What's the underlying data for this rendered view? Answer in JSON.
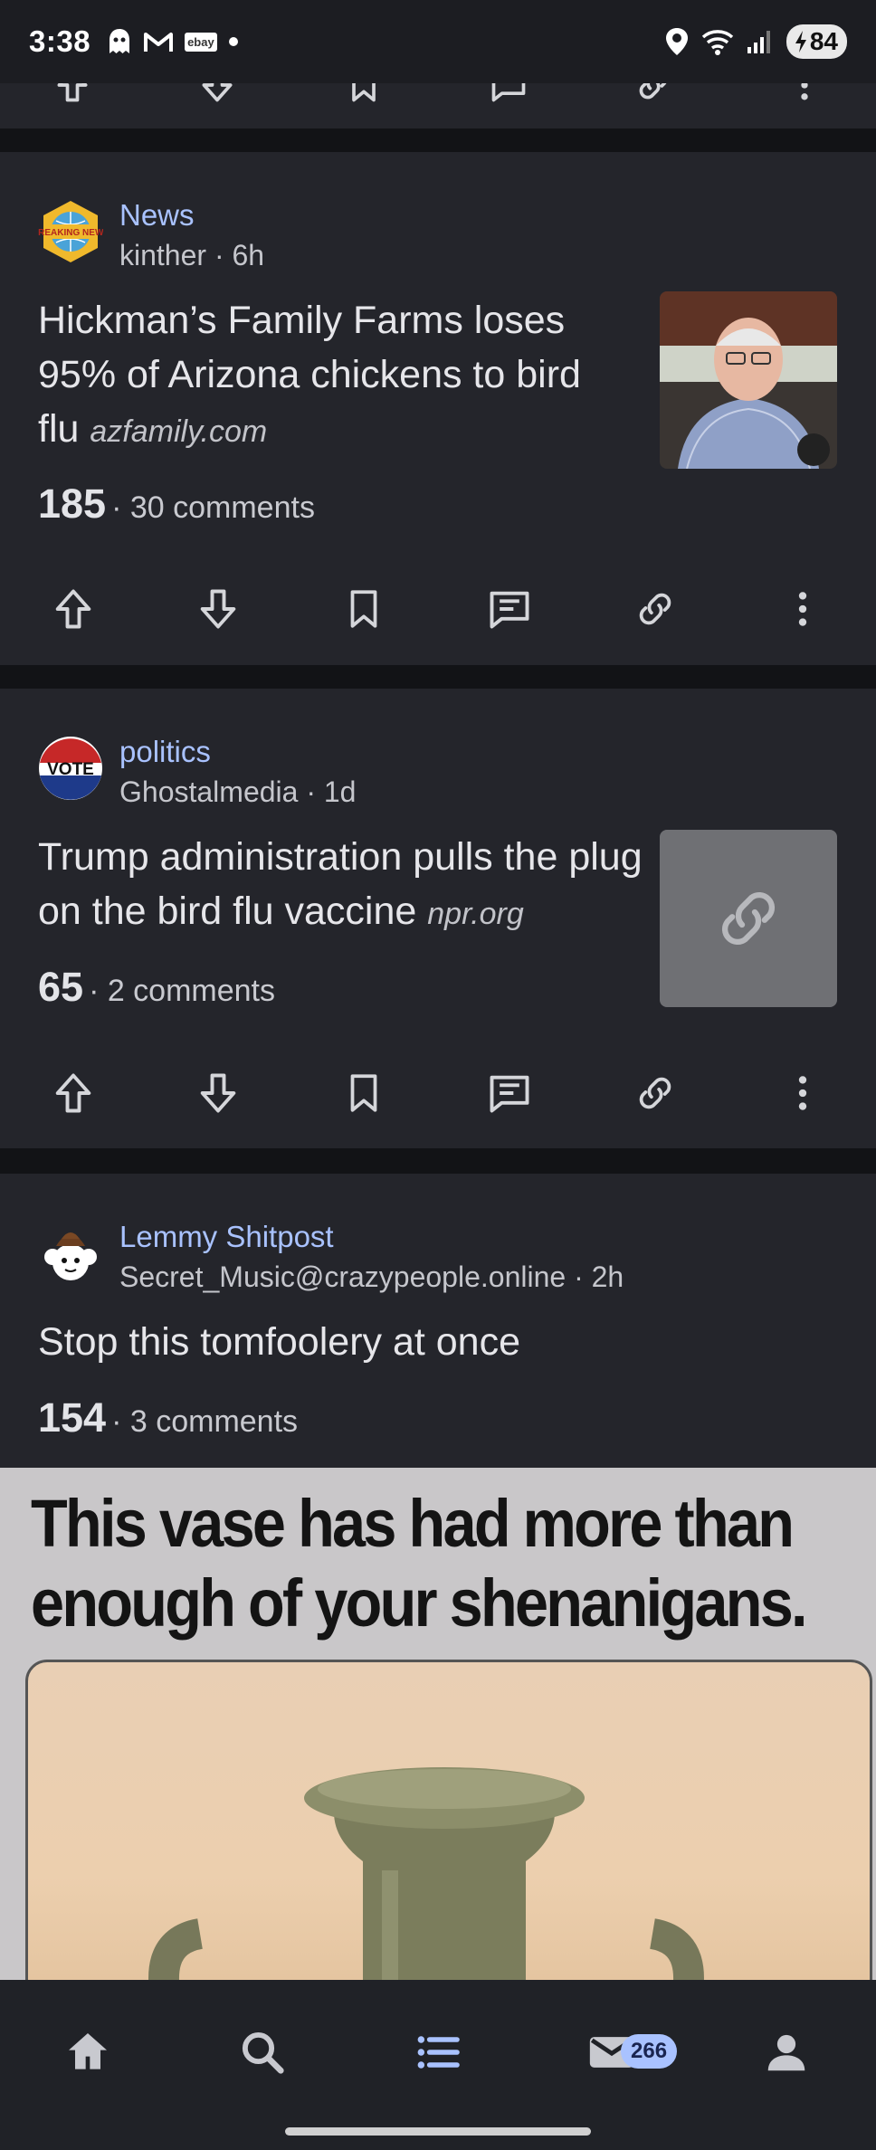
{
  "status_bar": {
    "time": "3:38",
    "left_icons": [
      "ghost-icon",
      "gmail-icon",
      "ebay-icon",
      "dot-icon"
    ],
    "ebay_label": "ebay",
    "right_icons": [
      "location-icon",
      "wifi-icon",
      "signal-icon"
    ],
    "battery": "84"
  },
  "posts": [
    {
      "community": "News",
      "author": "kinther",
      "age": "6h",
      "meta": "kinther · 6h",
      "title": "Hickman’s Family Farms loses 95% of Arizona chickens to bird flu",
      "domain": "azfamily.com",
      "score": "185",
      "comments": "· 30 comments",
      "avatar_label": "BREAKING NEWS"
    },
    {
      "community": "politics",
      "author": "Ghostalmedia",
      "age": "1d",
      "meta": "Ghostalmedia · 1d",
      "title": "Trump administration pulls the plug on the bird flu vaccine",
      "domain": "npr.org",
      "score": "65",
      "comments": "· 2 comments",
      "avatar_label": "VOTE"
    },
    {
      "community": "Lemmy Shitpost",
      "author": "Secret_Music@crazypeople.online",
      "age": "2h",
      "meta": "Secret_Music@crazypeople.online · 2h",
      "title": "Stop this tomfoolery at once",
      "score": "154",
      "comments": "· 3 comments",
      "image_caption_line1": "This vase has had more than",
      "image_caption_line2": "enough of your shenanigans."
    }
  ],
  "post_actions": [
    "upvote",
    "downvote",
    "save",
    "reply",
    "copy-link",
    "more"
  ],
  "bottom_nav": {
    "items": [
      "home",
      "search",
      "feed",
      "inbox",
      "profile"
    ],
    "active": "feed",
    "inbox_badge": "266"
  },
  "colors": {
    "background": "#1c1d22",
    "card": "#24252b",
    "accent": "#a9c2ff",
    "separator": "#121316"
  }
}
